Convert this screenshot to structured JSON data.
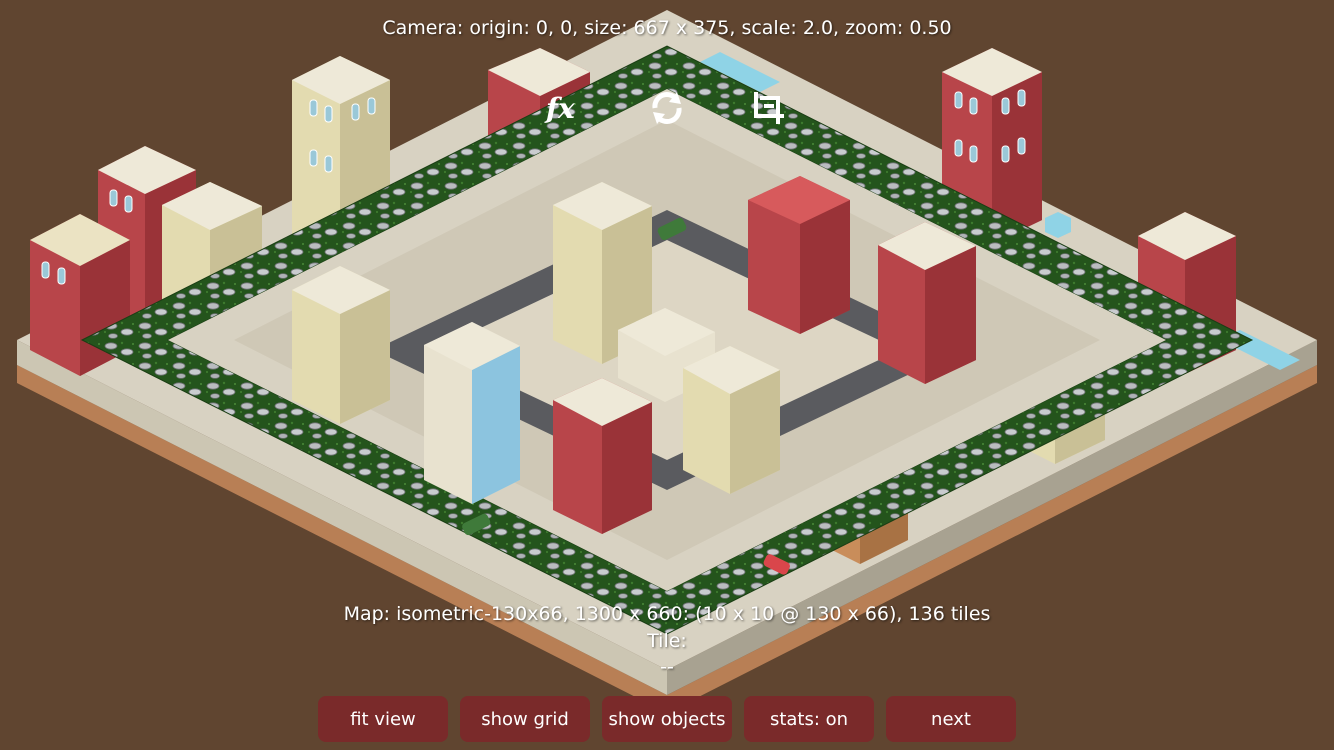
{
  "hud": {
    "camera_text": "Camera: origin: 0, 0, size: 667 x 375, scale: 2.0, zoom: 0.50",
    "map_text": "Map: isometric-130x66, 1300 x 660: (10 x 10 @ 130 x 66), 136 tiles",
    "tile_label": "Tile:",
    "tile_value": "--"
  },
  "toolbar_icons": [
    {
      "name": "fx-icon",
      "glyph": "fx"
    },
    {
      "name": "refresh-icon",
      "glyph": "refresh"
    },
    {
      "name": "crop-icon",
      "glyph": "crop"
    }
  ],
  "buttons": {
    "fit_view": "fit view",
    "show_grid": "show grid",
    "show_objects": "show objects",
    "stats": "stats: on",
    "next": "next"
  },
  "colors": {
    "background": "#604530",
    "button": "#7a2a2a",
    "text": "#ffffff",
    "grass": "#2a5a22",
    "plaza": "#d8d2c2",
    "road": "#55565a",
    "brick": "#b8454a",
    "cream": "#e3dbb0"
  }
}
